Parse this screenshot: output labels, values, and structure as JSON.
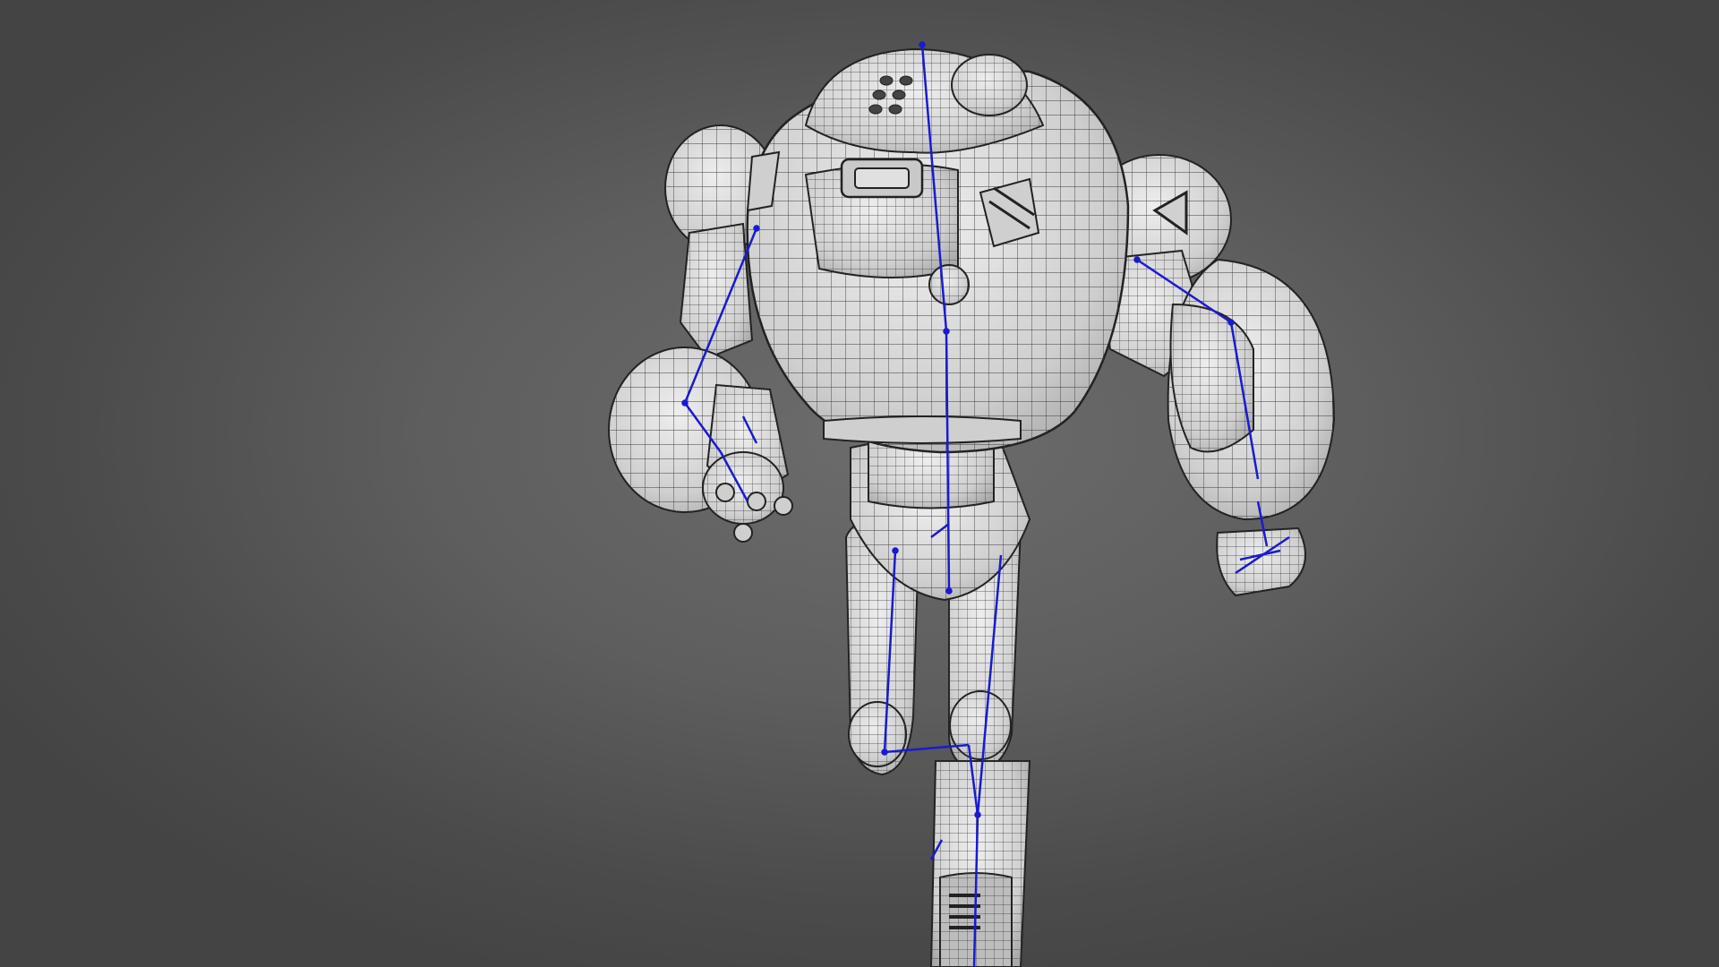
{
  "viewport": {
    "background_center": "#6c6c6c",
    "background_edge": "#444444"
  },
  "model": {
    "display_mode": "wireframe-on-shaded",
    "surface_color": "#d9d9d9",
    "wire_color": "#3a3a3a",
    "armature_color": "#1a1ad0"
  },
  "icons": [
    "robot-model",
    "armature-bones"
  ]
}
